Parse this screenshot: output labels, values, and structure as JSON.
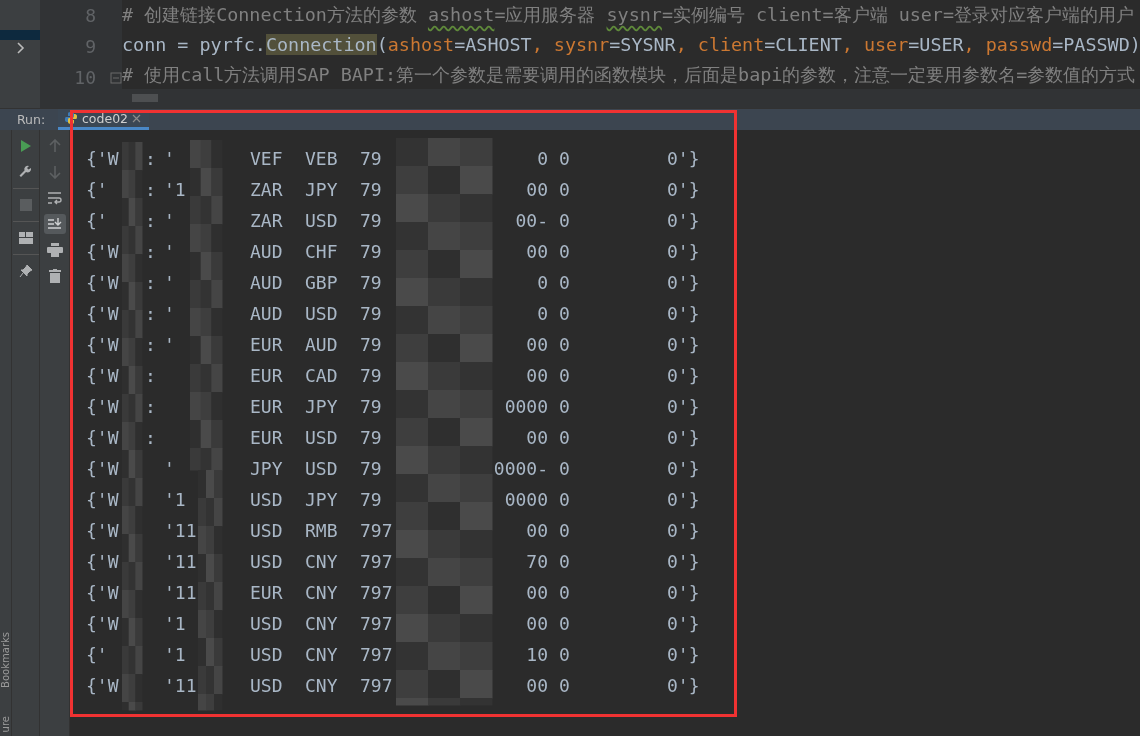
{
  "editor": {
    "lines": [
      {
        "number": "8",
        "tokens": [
          {
            "kind": "comment",
            "text": "# 创建链接Connection方法的参数 "
          },
          {
            "kind": "typo",
            "text": "ashost"
          },
          {
            "kind": "comment",
            "text": "=应用服务器 "
          },
          {
            "kind": "typo",
            "text": "sysnr"
          },
          {
            "kind": "comment",
            "text": "=实例编号 client=客户端 user=登录对应客户端的用户"
          }
        ]
      },
      {
        "number": "9",
        "tokens": [
          {
            "kind": "plain",
            "text": "conn = pyrfc."
          },
          {
            "kind": "highlight",
            "text": "Connection"
          },
          {
            "kind": "plain",
            "text": "("
          },
          {
            "kind": "param",
            "text": "ashost"
          },
          {
            "kind": "plain",
            "text": "=ASHOST"
          },
          {
            "kind": "punct",
            "text": ", "
          },
          {
            "kind": "param",
            "text": "sysnr"
          },
          {
            "kind": "plain",
            "text": "=SYSNR"
          },
          {
            "kind": "punct",
            "text": ", "
          },
          {
            "kind": "param",
            "text": "client"
          },
          {
            "kind": "plain",
            "text": "=CLIENT"
          },
          {
            "kind": "punct",
            "text": ", "
          },
          {
            "kind": "param",
            "text": "user"
          },
          {
            "kind": "plain",
            "text": "=USER"
          },
          {
            "kind": "punct",
            "text": ", "
          },
          {
            "kind": "param",
            "text": "passwd"
          },
          {
            "kind": "plain",
            "text": "=PASSWD)"
          }
        ]
      },
      {
        "number": "10",
        "fold": true,
        "tokens": [
          {
            "kind": "comment",
            "text": "# 使用call方法调用SAP BAPI:第一个参数是需要调用的函数模块，后面是bapi的参数，注意一定要用参数名=参数值的方式"
          }
        ]
      }
    ]
  },
  "run_panel": {
    "label": "Run:",
    "tabs": [
      {
        "label": "code02",
        "selected": true
      }
    ],
    "output_rows": [
      {
        "key": "{'W",
        "colon": ":",
        "value": "'",
        "from": "VEF",
        "to": "VEB",
        "num": "79",
        "tail": "0",
        "flag": "0",
        "end": "0'}"
      },
      {
        "key": "{'",
        "colon": ":",
        "value": "'1",
        "from": "ZAR",
        "to": "JPY",
        "num": "79",
        "tail": "00",
        "flag": "0",
        "end": "0'}"
      },
      {
        "key": "{'",
        "colon": ":",
        "value": "'",
        "from": "ZAR",
        "to": "USD",
        "num": "79",
        "tail": "00-",
        "flag": "0",
        "end": "0'}"
      },
      {
        "key": "{'W",
        "colon": ":",
        "value": "'",
        "from": "AUD",
        "to": "CHF",
        "num": "79",
        "tail": "00",
        "flag": "0",
        "end": "0'}"
      },
      {
        "key": "{'W",
        "colon": ":",
        "value": "'",
        "from": "AUD",
        "to": "GBP",
        "num": "79",
        "tail": "0",
        "flag": "0",
        "end": "0'}"
      },
      {
        "key": "{'W",
        "colon": ":",
        "value": "'",
        "from": "AUD",
        "to": "USD",
        "num": "79",
        "tail": "0",
        "flag": "0",
        "end": "0'}"
      },
      {
        "key": "{'W",
        "colon": ":",
        "value": "'",
        "from": "EUR",
        "to": "AUD",
        "num": "79",
        "tail": "00",
        "flag": "0",
        "end": "0'}"
      },
      {
        "key": "{'W",
        "colon": ":",
        "from": "EUR",
        "to": "CAD",
        "num": "79",
        "tail": "00",
        "flag": "0",
        "end": "0'}"
      },
      {
        "key": "{'W",
        "colon": ":",
        "from": "EUR",
        "to": "JPY",
        "num": "79",
        "tail": "0000",
        "flag": "0",
        "end": "0'}"
      },
      {
        "key": "{'W",
        "colon": ":",
        "from": "EUR",
        "to": "USD",
        "num": "79",
        "tail": "00",
        "flag": "0",
        "end": "0'}"
      },
      {
        "key": "{'W",
        "value": "'",
        "from": "JPY",
        "to": "USD",
        "num": "79",
        "tail": "0000-",
        "flag": "0",
        "end": "0'}"
      },
      {
        "key": "{'W",
        "value": "'1",
        "from": "USD",
        "to": "JPY",
        "num": "79",
        "tail": "0000",
        "flag": "0",
        "end": "0'}"
      },
      {
        "key": "{'W",
        "value": "'11",
        "from": "USD",
        "to": "RMB",
        "num": "797",
        "tail": "00",
        "flag": "0",
        "end": "0'}"
      },
      {
        "key": "{'W",
        "value": "'11",
        "from": "USD",
        "to": "CNY",
        "num": "797",
        "tail": "70",
        "flag": "0",
        "end": "0'}"
      },
      {
        "key": "{'W",
        "value": "'11",
        "from": "EUR",
        "to": "CNY",
        "num": "797",
        "tail": "00",
        "flag": "0",
        "end": "0'}"
      },
      {
        "key": "{'W",
        "value": "'1",
        "from": "USD",
        "to": "CNY",
        "num": "797",
        "tail": "00",
        "flag": "0",
        "end": "0'}"
      },
      {
        "key": "{'",
        "value": "'1",
        "from": "USD",
        "to": "CNY",
        "num": "797",
        "tail": "10",
        "flag": "0",
        "end": "0'}"
      },
      {
        "key": "{'W",
        "value": "'11",
        "from": "USD",
        "to": "CNY",
        "num": "797",
        "tail": "00",
        "flag": "0",
        "end": "0'}"
      }
    ]
  },
  "side_tabs": [
    {
      "label": "Bookmarks"
    },
    {
      "label": "ure"
    }
  ]
}
